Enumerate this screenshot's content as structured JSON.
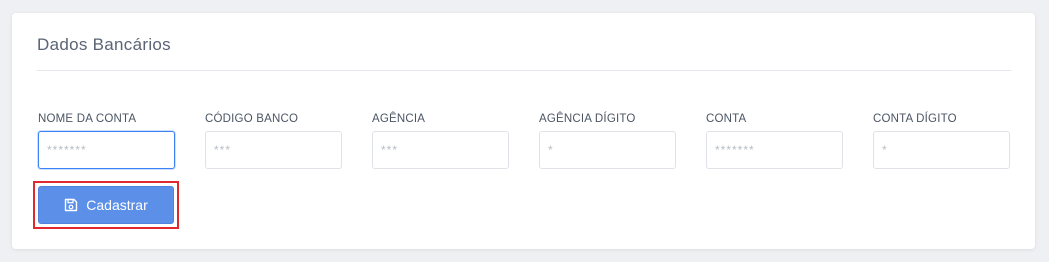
{
  "card": {
    "title": "Dados Bancários"
  },
  "fields": [
    {
      "label": "NOME DA CONTA",
      "placeholder": "*******",
      "value": ""
    },
    {
      "label": "CÓDIGO BANCO",
      "placeholder": "***",
      "value": ""
    },
    {
      "label": "AGÊNCIA",
      "placeholder": "***",
      "value": ""
    },
    {
      "label": "AGÊNCIA DÍGITO",
      "placeholder": "*",
      "value": ""
    },
    {
      "label": "CONTA",
      "placeholder": "*******",
      "value": ""
    },
    {
      "label": "CONTA DÍGITO",
      "placeholder": "*",
      "value": ""
    }
  ],
  "actions": {
    "submit_label": "Cadastrar",
    "submit_icon": "save-icon"
  },
  "colors": {
    "primary": "#5b8fe8",
    "focus_border": "#3b82f6",
    "highlight": "#e0282f",
    "title_text": "#5a6475"
  }
}
